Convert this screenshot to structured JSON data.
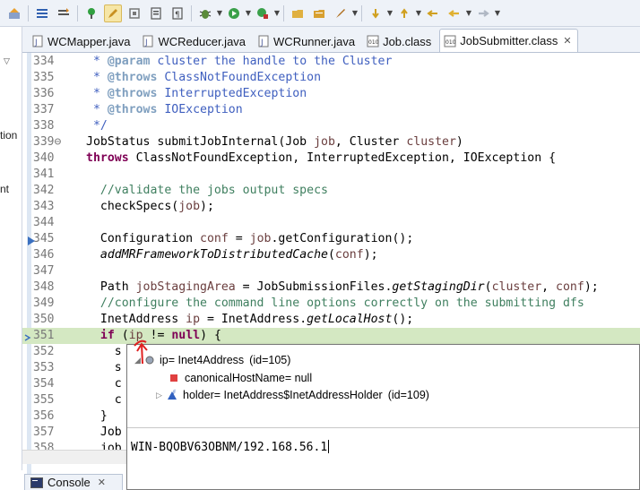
{
  "colors": {
    "comment": "#3f7f5f",
    "javadoc": "#3f5fbf",
    "keyword": "#7f0055",
    "current_line": "#d4e8c2",
    "annotation_red": "#e02020"
  },
  "left_strip": {
    "fragments": [
      "tion",
      "nt"
    ]
  },
  "tabs": [
    {
      "label": "WCMapper.java",
      "icon": "java-file-icon"
    },
    {
      "label": "WCReducer.java",
      "icon": "java-file-icon"
    },
    {
      "label": "WCRunner.java",
      "icon": "java-file-icon"
    },
    {
      "label": "Job.class",
      "icon": "class-file-icon"
    },
    {
      "label": "JobSubmitter.class",
      "icon": "class-file-icon",
      "active": true
    }
  ],
  "code_lines": [
    {
      "num": "334",
      "parts": [
        {
          "t": " * ",
          "c": "c-doc"
        },
        {
          "t": "@param",
          "c": "c-tag"
        },
        {
          "t": " cluster the handle to the Cluster",
          "c": "c-doc"
        }
      ]
    },
    {
      "num": "335",
      "parts": [
        {
          "t": " * ",
          "c": "c-doc"
        },
        {
          "t": "@throws",
          "c": "c-tag"
        },
        {
          "t": " ClassNotFoundException",
          "c": "c-doc"
        }
      ]
    },
    {
      "num": "336",
      "parts": [
        {
          "t": " * ",
          "c": "c-doc"
        },
        {
          "t": "@throws",
          "c": "c-tag"
        },
        {
          "t": " InterruptedException",
          "c": "c-doc"
        }
      ]
    },
    {
      "num": "337",
      "parts": [
        {
          "t": " * ",
          "c": "c-doc"
        },
        {
          "t": "@throws",
          "c": "c-tag"
        },
        {
          "t": " IOException",
          "c": "c-doc"
        }
      ]
    },
    {
      "num": "338",
      "parts": [
        {
          "t": " */",
          "c": "c-doc"
        }
      ]
    },
    {
      "num": "339",
      "marker": "⊖",
      "parts": [
        {
          "t": "JobStatus submitJobInternal(Job ",
          "c": ""
        },
        {
          "t": "job",
          "c": "c-param"
        },
        {
          "t": ", Cluster ",
          "c": ""
        },
        {
          "t": "cluster",
          "c": "c-param"
        },
        {
          "t": ")",
          "c": ""
        }
      ]
    },
    {
      "num": "340",
      "parts": [
        {
          "t": "throws",
          "c": "c-kw"
        },
        {
          "t": " ClassNotFoundException, InterruptedException, IOException {",
          "c": ""
        }
      ]
    },
    {
      "num": "341",
      "parts": []
    },
    {
      "num": "342",
      "parts": [
        {
          "t": "  //validate the jobs output specs",
          "c": "c-comment"
        }
      ]
    },
    {
      "num": "343",
      "parts": [
        {
          "t": "  checkSpecs(",
          "c": ""
        },
        {
          "t": "job",
          "c": "c-param"
        },
        {
          "t": ");",
          "c": ""
        }
      ]
    },
    {
      "num": "344",
      "parts": []
    },
    {
      "num": "345",
      "breakpoint": true,
      "parts": [
        {
          "t": "  Configuration ",
          "c": ""
        },
        {
          "t": "conf",
          "c": "c-param"
        },
        {
          "t": " = ",
          "c": ""
        },
        {
          "t": "job",
          "c": "c-param"
        },
        {
          "t": ".getConfiguration();",
          "c": ""
        }
      ]
    },
    {
      "num": "346",
      "parts": [
        {
          "t": "  ",
          "c": ""
        },
        {
          "t": "addMRFrameworkToDistributedCache",
          "c": "c-ital"
        },
        {
          "t": "(",
          "c": ""
        },
        {
          "t": "conf",
          "c": "c-param"
        },
        {
          "t": ");",
          "c": ""
        }
      ]
    },
    {
      "num": "347",
      "parts": []
    },
    {
      "num": "348",
      "parts": [
        {
          "t": "  Path ",
          "c": ""
        },
        {
          "t": "jobStagingArea",
          "c": "c-param"
        },
        {
          "t": " = JobSubmissionFiles.",
          "c": ""
        },
        {
          "t": "getStagingDir",
          "c": "c-ital"
        },
        {
          "t": "(",
          "c": ""
        },
        {
          "t": "cluster",
          "c": "c-param"
        },
        {
          "t": ", ",
          "c": ""
        },
        {
          "t": "conf",
          "c": "c-param"
        },
        {
          "t": ");",
          "c": ""
        }
      ]
    },
    {
      "num": "349",
      "parts": [
        {
          "t": "  //configure the command line options correctly on the submitting dfs",
          "c": "c-comment"
        }
      ]
    },
    {
      "num": "350",
      "parts": [
        {
          "t": "  InetAddress ",
          "c": ""
        },
        {
          "t": "ip",
          "c": "c-param"
        },
        {
          "t": " = InetAddress.",
          "c": ""
        },
        {
          "t": "getLocalHost",
          "c": "c-ital"
        },
        {
          "t": "();",
          "c": ""
        }
      ]
    },
    {
      "num": "351",
      "current": true,
      "parts": [
        {
          "t": "  ",
          "c": ""
        },
        {
          "t": "if",
          "c": "c-kw"
        },
        {
          "t": " (",
          "c": ""
        },
        {
          "t": "ip",
          "c": "c-param"
        },
        {
          "t": " != ",
          "c": ""
        },
        {
          "t": "null",
          "c": "c-kw"
        },
        {
          "t": ") {",
          "c": ""
        }
      ]
    },
    {
      "num": "352",
      "parts": [
        {
          "t": "    s",
          "c": ""
        }
      ]
    },
    {
      "num": "353",
      "parts": [
        {
          "t": "    s",
          "c": ""
        }
      ]
    },
    {
      "num": "354",
      "parts": [
        {
          "t": "    c",
          "c": ""
        }
      ]
    },
    {
      "num": "355",
      "parts": [
        {
          "t": "    c",
          "c": ""
        }
      ]
    },
    {
      "num": "356",
      "parts": [
        {
          "t": "  }",
          "c": ""
        }
      ]
    },
    {
      "num": "357",
      "parts": [
        {
          "t": "  Job",
          "c": ""
        }
      ]
    },
    {
      "num": "358",
      "parts": [
        {
          "t": "  job",
          "c": ""
        }
      ]
    }
  ],
  "popup": {
    "root": {
      "label": "ip= Inet4Address",
      "id": "(id=105)",
      "icon": "variable-icon"
    },
    "children": [
      {
        "label": "canonicalHostName= null",
        "icon": "private-field-icon"
      },
      {
        "label": "holder= InetAddress$InetAddressHolder",
        "id": "(id=109)",
        "icon": "final-field-icon"
      }
    ],
    "detail_value": "WIN-BQOBV63OBNM/192.168.56.1"
  },
  "console": {
    "label": "Console"
  }
}
